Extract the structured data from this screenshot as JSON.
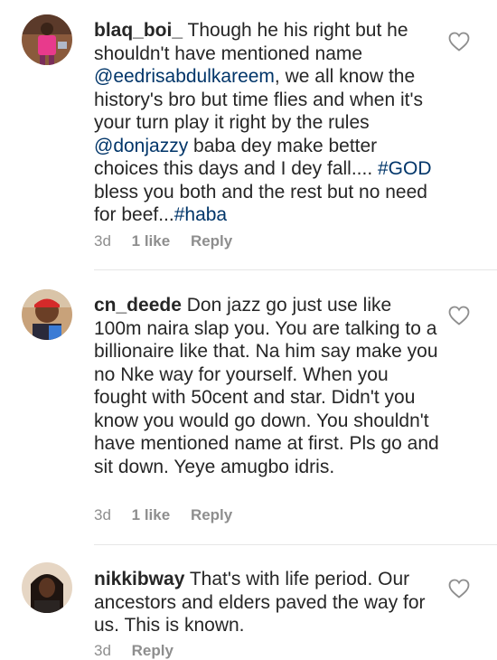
{
  "comments": [
    {
      "username": "blaq_boi_",
      "segments": [
        {
          "t": "Though he his right but he shouldn't have mentioned name ",
          "link": false
        },
        {
          "t": "@eedrisabdulkareem",
          "link": true
        },
        {
          "t": ", we all know the history's bro but time flies and when it's your turn play it right by the rules ",
          "link": false
        },
        {
          "t": "@donjazzy",
          "link": true
        },
        {
          "t": "  baba dey make better choices this days and I dey fall.... ",
          "link": false
        },
        {
          "t": "#GOD",
          "link": true
        },
        {
          "t": " bless you both and the rest but no need for beef...",
          "link": false
        },
        {
          "t": "#haba",
          "link": true
        }
      ],
      "time": "3d",
      "likes": "1 like",
      "reply": "Reply"
    },
    {
      "username": "cn_deede",
      "segments": [
        {
          "t": "Don jazz go just use like 100m naira slap you. You are talking to a billionaire like that. Na him say make you no Nke way for yourself. When you fought with 50cent and star. Didn't you know you would go down. You shouldn't have mentioned name at first. Pls go and sit down. Yeye amugbo idris.",
          "link": false
        }
      ],
      "time": "3d",
      "likes": "1 like",
      "reply": "Reply"
    },
    {
      "username": "nikkibway",
      "segments": [
        {
          "t": "That's with life period. Our ancestors and elders paved the way for us. This is known.",
          "link": false
        }
      ],
      "time": "3d",
      "likes": "",
      "reply": "Reply"
    }
  ]
}
